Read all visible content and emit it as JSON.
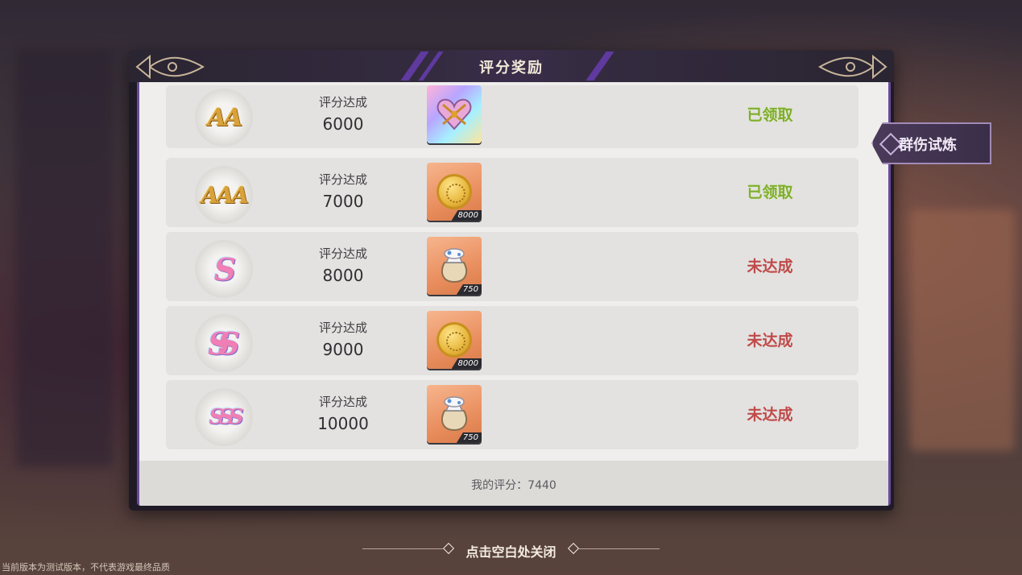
{
  "dialog": {
    "title": "评分奖励",
    "side_tab_label": "群伤试炼",
    "my_score_label": "我的评分：",
    "my_score_value": "7440",
    "close_hint": "点击空白处关闭"
  },
  "rewards": [
    {
      "rank": "AA",
      "requirement_label": "评分达成",
      "requirement_value": "6000",
      "item": "heart-box-icon",
      "count": "",
      "status": "已领取"
    },
    {
      "rank": "AAA",
      "requirement_label": "评分达成",
      "requirement_value": "7000",
      "item": "gold-coin-icon",
      "count": "8000",
      "status": "已领取"
    },
    {
      "rank": "S",
      "requirement_label": "评分达成",
      "requirement_value": "8000",
      "item": "material-bag-icon",
      "count": "750",
      "status": "未达成"
    },
    {
      "rank": "SS",
      "requirement_label": "评分达成",
      "requirement_value": "9000",
      "item": "gold-coin-icon",
      "count": "8000",
      "status": "未达成"
    },
    {
      "rank": "SSS",
      "requirement_label": "评分达成",
      "requirement_value": "10000",
      "item": "material-bag-icon",
      "count": "750",
      "status": "未达成"
    }
  ],
  "disclaimer": "当前版本为测试版本，不代表游戏最终品质",
  "colors": {
    "claimed": "#7fae2e",
    "unmet": "#c04a4a",
    "panel_border": "#6a4a9a"
  }
}
